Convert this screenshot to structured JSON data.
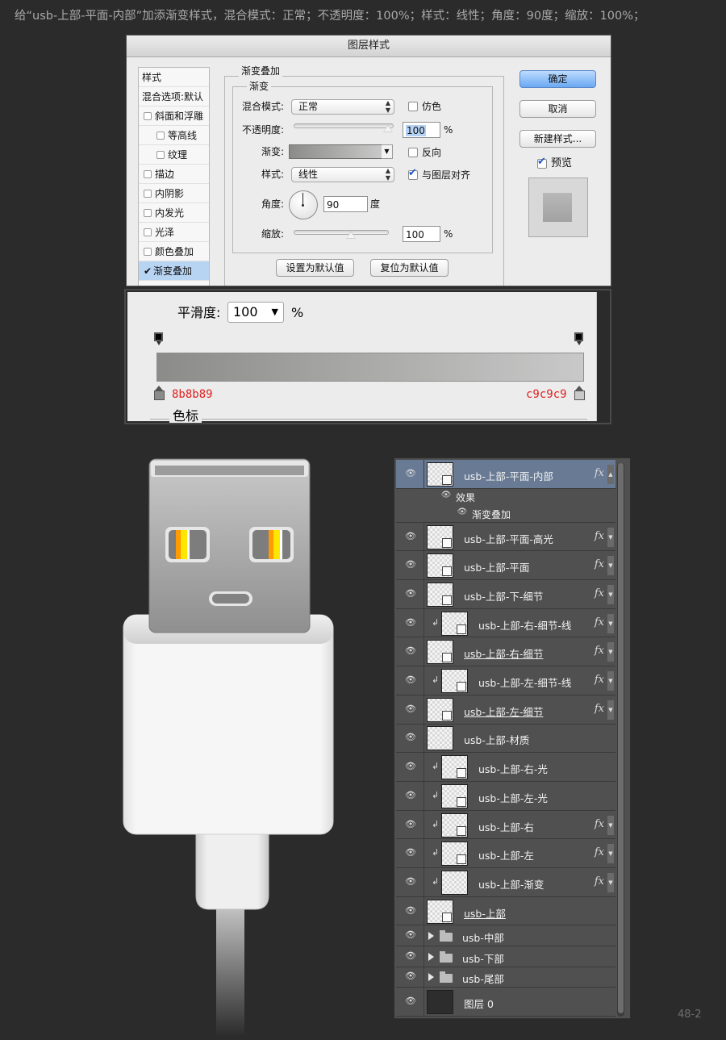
{
  "instruction": "给“usb-上部-平面-内部”加添渐变样式，混合模式：正常；不透明度：100%；样式：线性；角度：90度；缩放：100%；",
  "dialog": {
    "title": "图层样式",
    "styles_header": "样式",
    "blend_options": "混合选项:默认",
    "style_items": [
      {
        "label": "斜面和浮雕",
        "checked": false
      },
      {
        "label": "等高线",
        "checked": false
      },
      {
        "label": "纹理",
        "checked": false
      },
      {
        "label": "描边",
        "checked": false
      },
      {
        "label": "内阴影",
        "checked": false
      },
      {
        "label": "内发光",
        "checked": false
      },
      {
        "label": "光泽",
        "checked": false
      },
      {
        "label": "颜色叠加",
        "checked": false
      },
      {
        "label": "渐变叠加",
        "checked": true
      }
    ],
    "group_title": "渐变叠加",
    "subgroup_title": "渐变",
    "blend_mode_label": "混合模式:",
    "blend_mode_value": "正常",
    "dither_label": "仿色",
    "opacity_label": "不透明度:",
    "opacity_value": "100",
    "percent": "%",
    "gradient_label": "渐变:",
    "reverse_label": "反向",
    "style_label": "样式:",
    "style_value": "线性",
    "align_label": "与图层对齐",
    "angle_label": "角度:",
    "angle_value": "90",
    "degree": "度",
    "scale_label": "缩放:",
    "scale_value": "100",
    "set_default": "设置为默认值",
    "reset_default": "复位为默认值",
    "ok": "确定",
    "cancel": "取消",
    "new_style": "新建样式...",
    "preview_label": "预览",
    "preview_checked": true
  },
  "gradient_editor": {
    "smoothness_label": "平滑度:",
    "smoothness_value": "100",
    "percent": "%",
    "left_color": "8b8b89",
    "right_color": "c9c9c9",
    "color_stop_label": "色标"
  },
  "layers": [
    {
      "name": "usb-上部-平面-内部",
      "fx": true,
      "selected": true,
      "clipped": false,
      "underline": false,
      "type": "smart"
    },
    {
      "name": "效果",
      "type": "effect-header"
    },
    {
      "name": "渐变叠加",
      "type": "effect"
    },
    {
      "name": "usb-上部-平面-高光",
      "fx": true,
      "clipped": false,
      "underline": false,
      "type": "smart"
    },
    {
      "name": "usb-上部-平面",
      "fx": true,
      "clipped": false,
      "underline": false,
      "type": "smart"
    },
    {
      "name": "usb-上部-下-细节",
      "fx": true,
      "clipped": false,
      "underline": false,
      "type": "smart"
    },
    {
      "name": "usb-上部-右-细节-线",
      "fx": true,
      "clipped": true,
      "underline": false,
      "type": "smart"
    },
    {
      "name": "usb-上部-右-细节",
      "fx": true,
      "clipped": false,
      "underline": true,
      "type": "smart"
    },
    {
      "name": "usb-上部-左-细节-线",
      "fx": true,
      "clipped": true,
      "underline": false,
      "type": "smart"
    },
    {
      "name": "usb-上部-左-细节",
      "fx": true,
      "clipped": false,
      "underline": true,
      "type": "smart"
    },
    {
      "name": "usb-上部-材质",
      "fx": false,
      "clipped": false,
      "underline": false,
      "type": "pixel"
    },
    {
      "name": "usb-上部-右-光",
      "fx": false,
      "clipped": true,
      "underline": false,
      "type": "smart"
    },
    {
      "name": "usb-上部-左-光",
      "fx": false,
      "clipped": true,
      "underline": false,
      "type": "smart"
    },
    {
      "name": "usb-上部-右",
      "fx": true,
      "clipped": true,
      "underline": false,
      "type": "smart"
    },
    {
      "name": "usb-上部-左",
      "fx": true,
      "clipped": true,
      "underline": false,
      "type": "smart"
    },
    {
      "name": "usb-上部-渐变",
      "fx": true,
      "clipped": true,
      "underline": false,
      "type": "pixel"
    },
    {
      "name": "usb-上部",
      "fx": false,
      "clipped": false,
      "underline": true,
      "type": "smart"
    },
    {
      "name": "usb-中部",
      "type": "folder"
    },
    {
      "name": "usb-下部",
      "type": "folder"
    },
    {
      "name": "usb-尾部",
      "type": "folder"
    },
    {
      "name": "图层 0",
      "type": "dark"
    }
  ],
  "page_number": "48-2",
  "colors": {
    "gradient_start": "#8b8b89",
    "gradient_end": "#c9c9c9",
    "selected_layer": "#687a94",
    "connector_yellow": "#ffe600",
    "connector_orange": "#ff9b00"
  }
}
